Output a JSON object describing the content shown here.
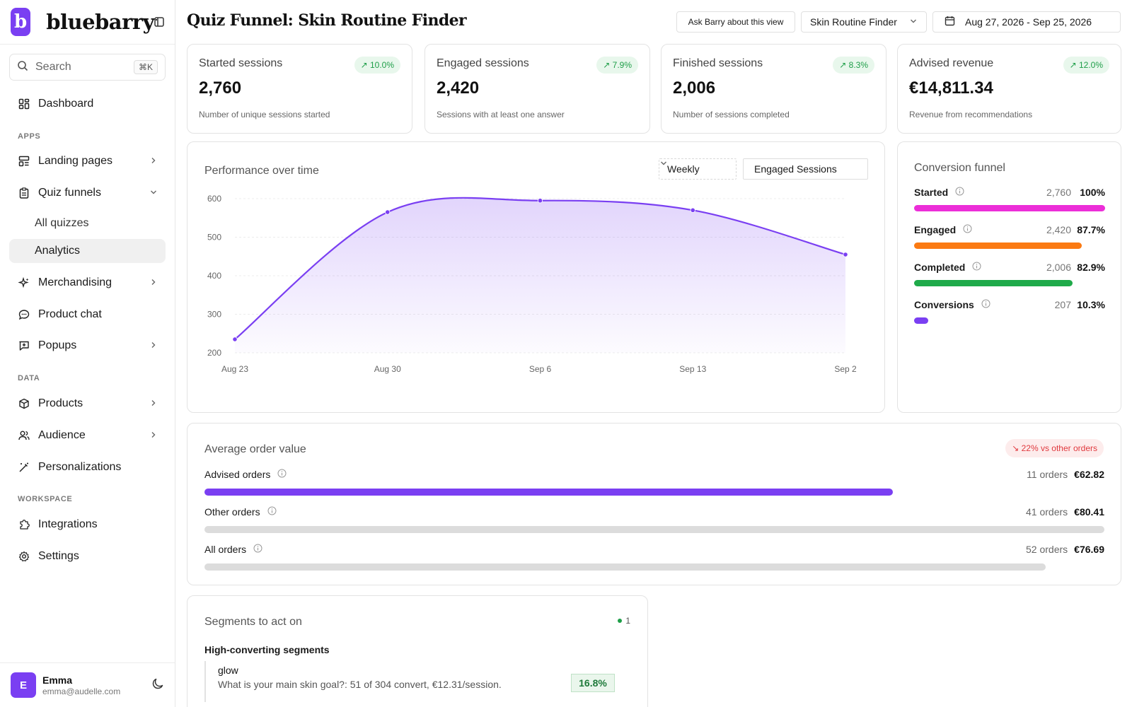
{
  "brand": {
    "logo_letter": "b",
    "name": "bluebarry",
    "accent": "#7a3ff2"
  },
  "sidebar": {
    "search": {
      "placeholder": "Search",
      "shortcut": "⌘K"
    },
    "dashboard": "Dashboard",
    "sections": {
      "apps": "APPS",
      "data": "DATA",
      "workspace": "WORKSPACE"
    },
    "items": {
      "landing_pages": "Landing pages",
      "quiz_funnels": "Quiz funnels",
      "all_quizzes": "All quizzes",
      "analytics": "Analytics",
      "merchandising": "Merchandising",
      "product_chat": "Product chat",
      "popups": "Popups",
      "products": "Products",
      "audience": "Audience",
      "personalizations": "Personalizations",
      "integrations": "Integrations",
      "settings": "Settings"
    },
    "user": {
      "initial": "E",
      "name": "Emma",
      "email": "emma@audelle.com"
    }
  },
  "header": {
    "title": "Quiz Funnel: Skin Routine Finder",
    "ask_button": "Ask Barry about this view",
    "quiz_select": "Skin Routine Finder",
    "date_range": "Aug 27, 2026 - Sep 25, 2026"
  },
  "kpis": [
    {
      "label": "Started sessions",
      "value": "2,760",
      "sub": "Number of unique sessions started",
      "change": "10.0%"
    },
    {
      "label": "Engaged sessions",
      "value": "2,420",
      "sub": "Sessions with at least one answer",
      "change": "7.9%"
    },
    {
      "label": "Finished sessions",
      "value": "2,006",
      "sub": "Number of sessions completed",
      "change": "8.3%"
    },
    {
      "label": "Advised revenue",
      "value": "€14,811.34",
      "sub": "Revenue from recommendations",
      "change": "12.0%"
    }
  ],
  "performance": {
    "title": "Performance over time",
    "interval": "Weekly",
    "metric": "Engaged Sessions"
  },
  "chart_data": {
    "type": "area",
    "x": [
      "Aug 23",
      "Aug 30",
      "Sep 6",
      "Sep 13",
      "Sep 2"
    ],
    "values": [
      235,
      565,
      595,
      570,
      455
    ],
    "yticks": [
      600,
      500,
      400,
      300,
      200
    ],
    "ylim": [
      200,
      600
    ],
    "color": "#7a3ff2",
    "grid": true
  },
  "funnel": {
    "title": "Conversion funnel",
    "rows": [
      {
        "name": "Started",
        "count": "2,760",
        "pct": "100%",
        "fraction": 1.0,
        "color": "#ec2ed8"
      },
      {
        "name": "Engaged",
        "count": "2,420",
        "pct": "87.7%",
        "fraction": 0.877,
        "color": "#fb7a12"
      },
      {
        "name": "Completed",
        "count": "2,006",
        "pct": "82.9%",
        "fraction": 0.829,
        "color": "#1faa4a"
      },
      {
        "name": "Conversions",
        "count": "207",
        "pct": "10.3%",
        "fraction": 0.075,
        "color": "#7a3ff2"
      }
    ]
  },
  "aov": {
    "title": "Average order value",
    "badge": "22% vs other orders",
    "rows": [
      {
        "name": "Advised orders",
        "orders": "11 orders",
        "value": "€62.82",
        "fraction": 0.765,
        "color": "#7a3ff2"
      },
      {
        "name": "Other orders",
        "orders": "41 orders",
        "value": "€80.41",
        "fraction": 1.0,
        "color": "#dcdcdc"
      },
      {
        "name": "All orders",
        "orders": "52 orders",
        "value": "€76.69",
        "fraction": 0.935,
        "color": "#dcdcdc"
      }
    ]
  },
  "segments": {
    "title": "Segments to act on",
    "count": "1",
    "subhead": "High-converting segments",
    "items": [
      {
        "name": "glow",
        "desc": "What is your main skin goal?: 51 of 304 convert, €12.31/session.",
        "pct": "16.8%"
      }
    ]
  }
}
